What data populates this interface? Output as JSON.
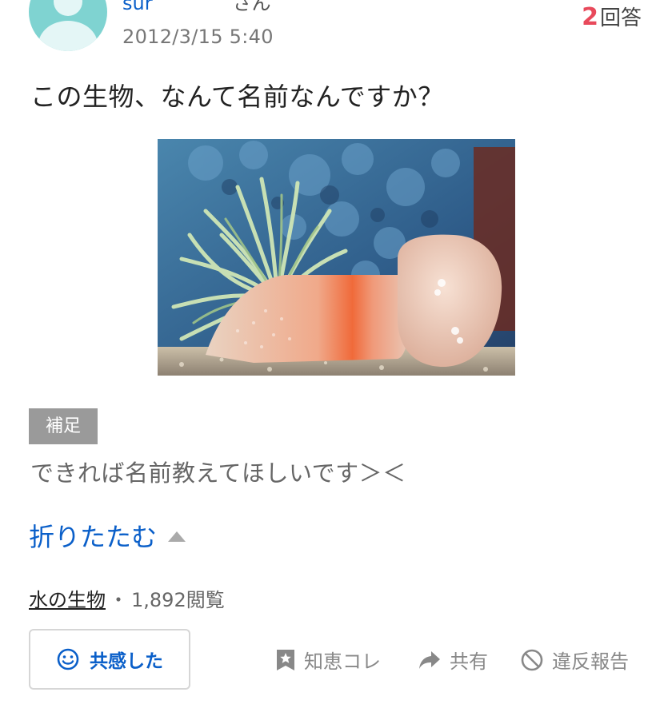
{
  "header": {
    "username": "sur",
    "user_suffix": "さん",
    "date": "2012/3/15 5:40",
    "answer_count": "2",
    "answer_label": "回答"
  },
  "question": {
    "text": "この生物、なんて名前なんですか？"
  },
  "supplement": {
    "tag": "補足",
    "text": "できれば名前教えてほしいです＞＜"
  },
  "fold": {
    "label": "折りたたむ"
  },
  "meta": {
    "category": "水の生物",
    "separator": "・",
    "views": "1,892閲覧"
  },
  "actions": {
    "empathy_label": "共感した",
    "chiebukuro_label": "知恵コレ",
    "share_label": "共有",
    "report_label": "違反報告"
  },
  "colors": {
    "link_blue": "#0a5fc9",
    "answer_count_red": "#e8495b",
    "avatar_teal": "#7fd3d1",
    "tag_gray": "#9a9a9a"
  },
  "icons": {
    "avatar": "default-user-avatar",
    "fold": "triangle-up-icon",
    "empathy": "smile-icon",
    "chiebukuro": "bookmark-star-icon",
    "share": "share-arrow-icon",
    "report": "prohibited-icon"
  }
}
